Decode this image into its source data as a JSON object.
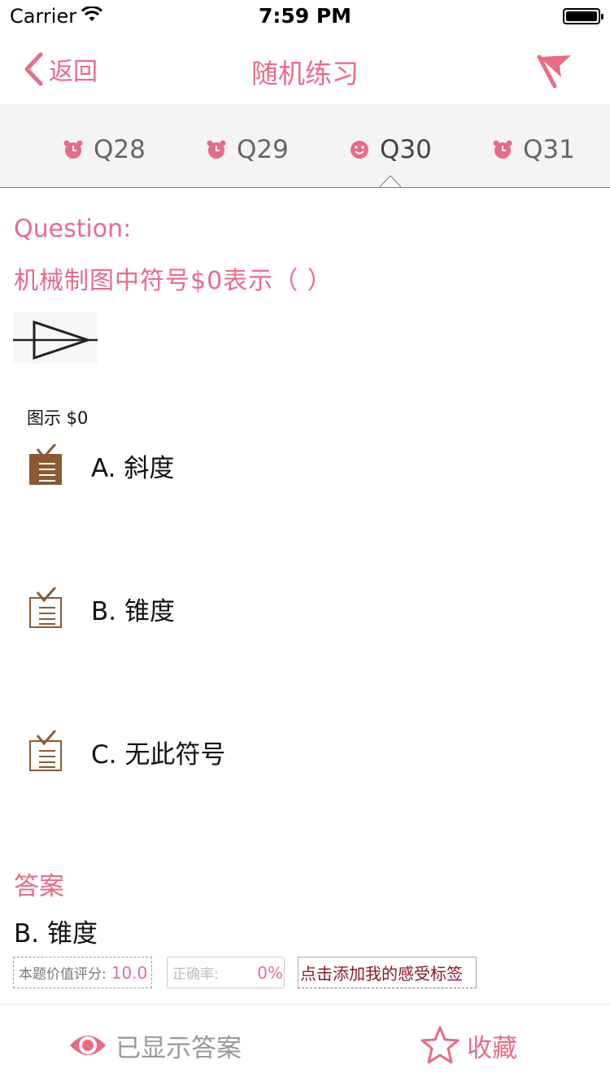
{
  "status_bar": {
    "carrier": "Carrier",
    "time": "7:59 PM"
  },
  "nav": {
    "back_label": "返回",
    "title": "随机练习"
  },
  "tabs": [
    {
      "label": "Q28",
      "icon": "alarm-clock-icon"
    },
    {
      "label": "Q29",
      "icon": "alarm-clock-icon"
    },
    {
      "label": "Q30",
      "icon": "smiley-icon",
      "active": true
    },
    {
      "label": "Q31",
      "icon": "alarm-clock-icon"
    }
  ],
  "question": {
    "heading": "Question:",
    "text": "机械制图中符号$0表示（  ）",
    "image_caption": "图示 $0"
  },
  "options": [
    {
      "label": "A. 斜度",
      "selected": true
    },
    {
      "label": "B. 锥度",
      "selected": false
    },
    {
      "label": "C. 无此符号",
      "selected": false
    }
  ],
  "answer": {
    "heading": "答案",
    "text": "B. 锥度",
    "score_label": "本题价值评分:",
    "score_value": "10.0",
    "rate_label": "正确率:",
    "rate_value": "0%",
    "tag_label": "点击添加我的感受标签"
  },
  "bottom_bar": {
    "show_answer_label": "已显示答案",
    "favorite_label": "收藏"
  },
  "colors": {
    "accent": "#e76c85",
    "option_icon": "#8b5a34",
    "tag_text": "#8a1a2c"
  }
}
